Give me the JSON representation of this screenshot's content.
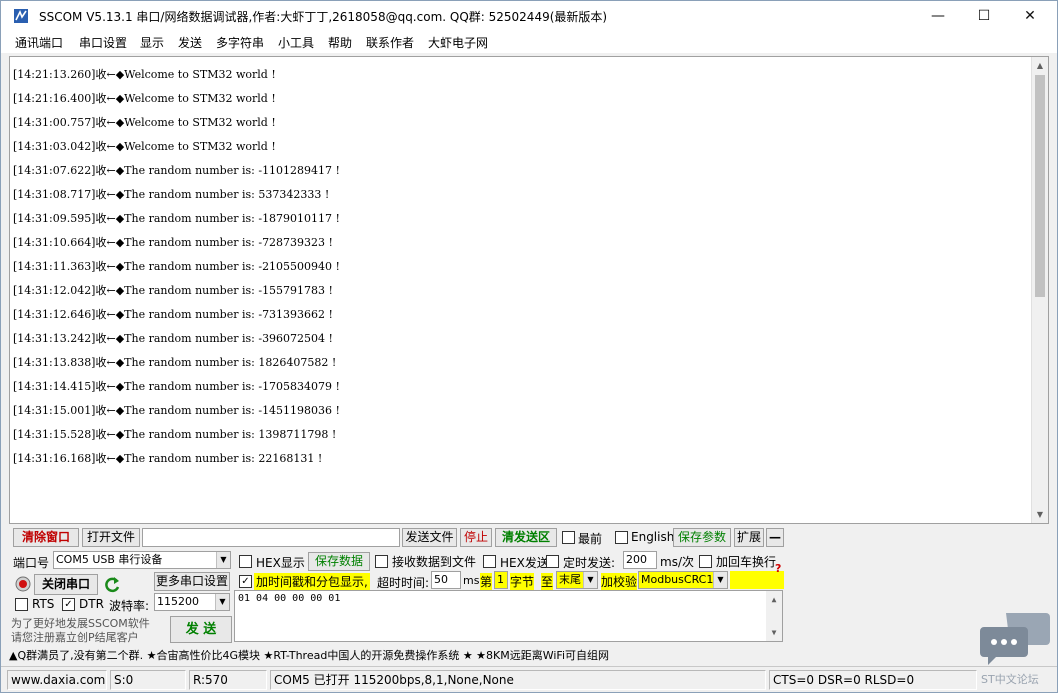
{
  "window": {
    "title": "SSCOM V5.13.1 串口/网络数据调试器,作者:大虾丁丁,2618058@qq.com. QQ群: 52502449(最新版本)",
    "minimize": "—",
    "maximize": "☐",
    "close": "✕"
  },
  "menu": [
    "通讯端口",
    "串口设置",
    "显示",
    "发送",
    "多字符串",
    "小工具",
    "帮助",
    "联系作者",
    "大虾电子网"
  ],
  "receive_log": [
    "[14:21:13.260]收←◆Welcome to STM32 world !",
    "[14:21:16.400]收←◆Welcome to STM32 world !",
    "[14:31:00.757]收←◆Welcome to STM32 world !",
    "[14:31:03.042]收←◆Welcome to STM32 world !",
    "[14:31:07.622]收←◆The random number is: -1101289417 !",
    "[14:31:08.717]收←◆The random number is: 537342333 !",
    "[14:31:09.595]收←◆The random number is: -1879010117 !",
    "[14:31:10.664]收←◆The random number is: -728739323 !",
    "[14:31:11.363]收←◆The random number is: -2105500940 !",
    "[14:31:12.042]收←◆The random number is: -155791783 !",
    "[14:31:12.646]收←◆The random number is: -731393662 !",
    "[14:31:13.242]收←◆The random number is: -396072504 !",
    "[14:31:13.838]收←◆The random number is: 1826407582 !",
    "[14:31:14.415]收←◆The random number is: -1705834079 !",
    "[14:31:15.001]收←◆The random number is: -1451198036 !",
    "[14:31:15.528]收←◆The random number is: 1398711798 !",
    "[14:31:16.168]收←◆The random number is: 22168131 !"
  ],
  "toolbar": {
    "clear_window": "清除窗口",
    "open_file": "打开文件",
    "file_path": "",
    "send_file": "发送文件",
    "stop": "停止",
    "clear_send": "清发送区",
    "topmost": "最前",
    "english": "English",
    "save_params": "保存参数",
    "expand": "扩展",
    "collapse": "—"
  },
  "port": {
    "port_label": "端口号",
    "port_value": "COM5 USB 串行设备",
    "close_port": "关闭串口",
    "more_settings": "更多串口设置",
    "rts": "RTS",
    "dtr": "DTR",
    "baud_label": "波特率:",
    "baud_value": "115200"
  },
  "options": {
    "hex_display": "HEX显示",
    "save_data": "保存数据",
    "recv_to_file": "接收数据到文件",
    "hex_send": "HEX发送",
    "timed_send": "定时发送:",
    "interval": "200",
    "interval_unit": "ms/次",
    "add_crlf": "加回车换行",
    "timestamp": "加时间戳和分包显示,",
    "timeout_label": "超时时间:",
    "timeout_value": "50",
    "timeout_unit": "ms",
    "byte_prefix": "第",
    "byte_index": "1",
    "byte_unit": "字节",
    "to_label": "至",
    "to_value": "末尾",
    "checksum_label": "加校验",
    "checksum_value": "ModbusCRC16",
    "help_mark": "?"
  },
  "send_text": "01 04 00 00 00 01",
  "promo": {
    "line1": "为了更好地发展SSCOM软件",
    "line2": "请您注册嘉立创P结尾客户",
    "send_button": "发 送"
  },
  "ad_text": "▲Q群满员了,没有第二个群. ★合宙高性价比4G模块 ★RT-Thread中国人的开源免费操作系统 ★ ★8KM远距离WiFi可自组网",
  "status": {
    "website": "www.daxia.com",
    "sent": "S:0",
    "received": "R:570",
    "port_state": "COM5 已打开  115200bps,8,1,None,None",
    "lines": "CTS=0 DSR=0 RLSD=0"
  },
  "watermark": "ST中文论坛",
  "icons": {
    "app": "sscom-app-icon",
    "refresh": "refresh-icon",
    "port_led": "port-status-icon",
    "chat": "chat-bubble-icon"
  }
}
